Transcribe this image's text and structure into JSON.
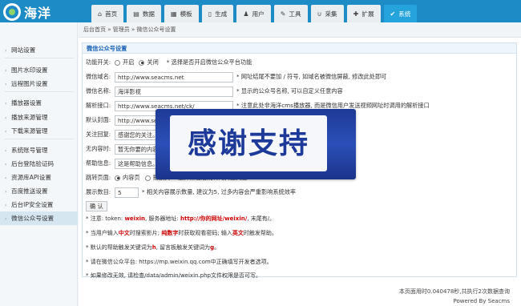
{
  "logo": {
    "text": "海洋"
  },
  "nav": [
    {
      "label": "首页",
      "icon": "home-icon",
      "glyph": "⌂"
    },
    {
      "label": "数据",
      "icon": "book-icon",
      "glyph": "▤"
    },
    {
      "label": "模板",
      "icon": "file-icon",
      "glyph": "▦"
    },
    {
      "label": "生成",
      "icon": "document-icon",
      "glyph": "▯"
    },
    {
      "label": "用户",
      "icon": "user-icon",
      "glyph": "♟"
    },
    {
      "label": "工具",
      "icon": "wrench-icon",
      "glyph": "✎"
    },
    {
      "label": "采集",
      "icon": "magnet-icon",
      "glyph": "∪"
    },
    {
      "label": "扩展",
      "icon": "puzzle-icon",
      "glyph": "✚"
    },
    {
      "label": "系统",
      "icon": "settings-icon",
      "glyph": "✔",
      "active": true
    }
  ],
  "sidebar": [
    {
      "label": "网站设置"
    },
    {
      "label": "图片水印设置"
    },
    {
      "label": "远程图片设置"
    },
    {
      "label": "播放器设置"
    },
    {
      "label": "播放来源管理"
    },
    {
      "label": "下载来源管理"
    },
    {
      "label": "系统账号管理"
    },
    {
      "label": "后台登陆验证码"
    },
    {
      "label": "资源库API设置"
    },
    {
      "label": "百度推送设置"
    },
    {
      "label": "后台IP安全设置"
    },
    {
      "label": "微信公众号设置",
      "active": true
    }
  ],
  "breadcrumb": "后台首页 » 管理员 » 微信公众号设置",
  "panel": {
    "title": "微信公众号设置",
    "func": {
      "label": "功能开关:",
      "opt_on": "开启",
      "opt_off": "关闭",
      "hint": "* 选择是否开启微信公众平台功能"
    },
    "domain": {
      "label": "微信域名:",
      "value": "http://www.seacms.net",
      "hint": "* 网址结尾不要加 / 符号, 如域名被微信屏蔽, 修改此处即可"
    },
    "name": {
      "label": "微信名称:",
      "value": "海洋影视",
      "hint": "* 显示的公众号名称, 可以自定义任意内容"
    },
    "api": {
      "label": "解析接口:",
      "value": "http://www.seacms.net/ck/",
      "hint": "* 注意此处非海洋cms播放器, 而是微信用户发送视频网址时调用的解析接口"
    },
    "cover": {
      "label": "默认封面:",
      "value": "http://www.seac"
    },
    "follow": {
      "label": "关注回复:",
      "value": "感谢您的关注。"
    },
    "noresult": {
      "label": "无内容时:",
      "value": "暂无你要的内容。"
    },
    "help": {
      "label": "帮助信息:",
      "value": "这是帮助信息。"
    },
    "jump": {
      "label": "跳转页面:",
      "opt_in": "内容页",
      "opt_play": "播放页",
      "hint": "选择点击后跳转的页面类型"
    },
    "count": {
      "label": "展示数目:",
      "value": "5",
      "hint": "* 相关内容展示数量, 建议为5, 过多内容会严重影响系统效率"
    },
    "submit": "确 认",
    "notes": [
      {
        "parts": [
          {
            "t": "* 注意: token: ",
            "red": false
          },
          {
            "t": "weixin",
            "red": true
          },
          {
            "t": ", 服务器地址: ",
            "red": false
          },
          {
            "t": "http://你的网址/weixin/",
            "red": true
          },
          {
            "t": ", 末尾有/。",
            "red": false
          }
        ]
      },
      {
        "parts": [
          {
            "t": "* 当用户输入",
            "red": false
          },
          {
            "t": "中文",
            "red": true
          },
          {
            "t": "时搜索影片; ",
            "red": false
          },
          {
            "t": "纯数字",
            "red": true
          },
          {
            "t": "时获取观看密码; 输入",
            "red": false
          },
          {
            "t": "英文",
            "red": true
          },
          {
            "t": "时触发帮助。",
            "red": false
          }
        ]
      },
      {
        "parts": [
          {
            "t": "* 默认的帮助触发关键词为",
            "red": false
          },
          {
            "t": "h",
            "red": true
          },
          {
            "t": ", 留言板触发关键词为",
            "red": false
          },
          {
            "t": "g",
            "red": true
          },
          {
            "t": "。",
            "red": false
          }
        ]
      },
      {
        "parts": [
          {
            "t": "* 请在微信公众平台: https://mp.weixin.qq.com中正确填写开发者选项。",
            "red": false
          }
        ]
      },
      {
        "parts": [
          {
            "t": "* 如果修改无效, 请检查/data/admin/weixin.php文件权限是否可写。",
            "red": false
          }
        ]
      }
    ]
  },
  "footer": {
    "stats": "本页面用时0.040478秒,共执行2次数据查询",
    "powered": "Powered By Seacms"
  },
  "banner": {
    "text": "感谢支持"
  }
}
